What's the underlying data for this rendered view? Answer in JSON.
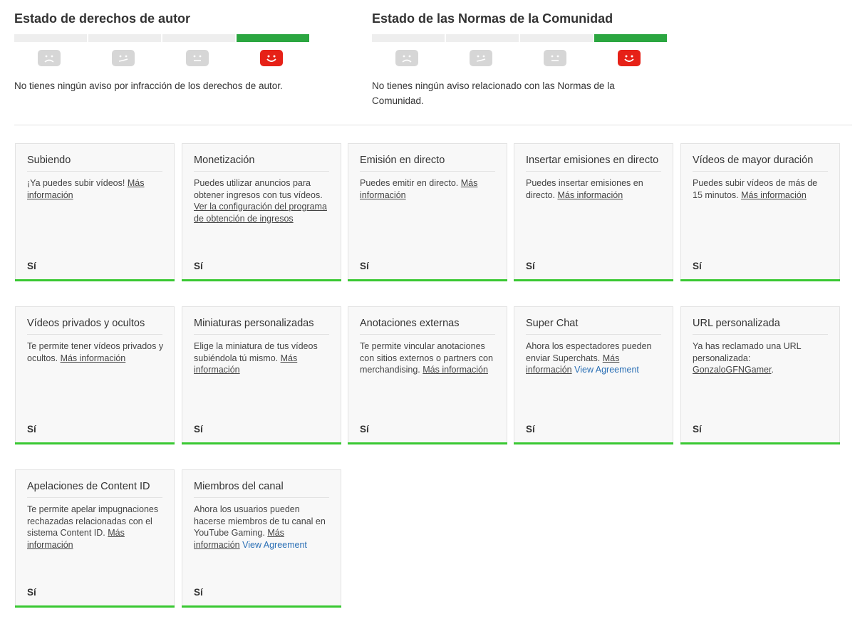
{
  "copyright": {
    "title": "Estado de derechos de autor",
    "message": "No tienes ningún aviso por infracción de los derechos de autor.",
    "active_index": 3
  },
  "community": {
    "title": "Estado de las Normas de la Comunidad",
    "message": "No tienes ningún aviso relacionado con las Normas de la Comunidad.",
    "active_index": 3
  },
  "colors": {
    "active_bar": "#2ba640",
    "active_face": "#e62117",
    "card_bottom": "#39c832",
    "agreement_link": "#2a6fb5"
  },
  "features": [
    {
      "title": "Subiendo",
      "text": "¡Ya puedes subir vídeos! ",
      "link": "Más información",
      "status": "Sí"
    },
    {
      "title": "Monetización",
      "text": "Puedes utilizar anuncios para obtener ingresos con tus vídeos. ",
      "link": "Ver la configuración del programa de obtención de ingresos",
      "status": "Sí"
    },
    {
      "title": "Emisión en directo",
      "text": "Puedes emitir en directo. ",
      "link": "Más información",
      "status": "Sí"
    },
    {
      "title": "Insertar emisiones en directo",
      "text": "Puedes insertar emisiones en directo. ",
      "link": "Más información",
      "status": "Sí"
    },
    {
      "title": "Vídeos de mayor duración",
      "text": "Puedes subir vídeos de más de 15 minutos. ",
      "link": "Más información",
      "status": "Sí"
    },
    {
      "title": "Vídeos privados y ocultos",
      "text": "Te permite tener vídeos privados y ocultos. ",
      "link": "Más información",
      "status": "Sí"
    },
    {
      "title": "Miniaturas personalizadas",
      "text": "Elige la miniatura de tus vídeos subiéndola tú mismo. ",
      "link": "Más información",
      "status": "Sí"
    },
    {
      "title": "Anotaciones externas",
      "text": "Te permite vincular anotaciones con sitios externos o partners con merchandising. ",
      "link": "Más información",
      "status": "Sí"
    },
    {
      "title": "Super Chat",
      "text": "Ahora los espectadores pueden enviar Superchats. ",
      "link": "Más información",
      "extra_link": "View Agreement",
      "status": "Sí"
    },
    {
      "title": "URL personalizada",
      "text": "Ya has reclamado una URL personalizada: ",
      "link": "GonzaloGFNGamer",
      "after": ".",
      "status": "Sí"
    },
    {
      "title": "Apelaciones de Content ID",
      "text": "Te permite apelar impugnaciones rechazadas relacionadas con el sistema Content ID. ",
      "link": "Más información",
      "status": "Sí"
    },
    {
      "title": "Miembros del canal",
      "text": "Ahora los usuarios pueden hacerse miembros de tu canal en YouTube Gaming. ",
      "link": "Más información",
      "extra_link": "View Agreement",
      "status": "Sí"
    }
  ]
}
